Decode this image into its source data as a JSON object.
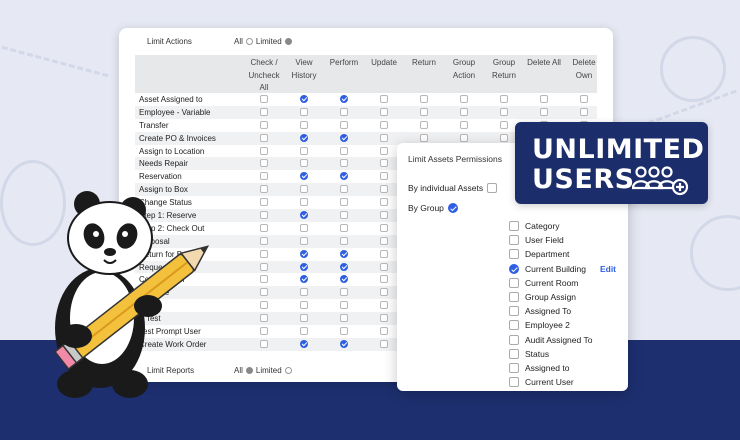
{
  "limit_actions": {
    "label": "Limit Actions",
    "all": "All",
    "limited": "Limited"
  },
  "limit_reports": {
    "label": "Limit Reports",
    "all": "All",
    "limited": "Limited"
  },
  "columns": [
    "Check / Uncheck All",
    "View History",
    "Perform",
    "Update",
    "Return",
    "Group Action",
    "Group Return",
    "Delete All",
    "Delete Own"
  ],
  "rows": [
    {
      "name": "Asset Assigned to",
      "checks": [
        false,
        true,
        true,
        false,
        false,
        false,
        false,
        false,
        false
      ]
    },
    {
      "name": "Employee - Variable",
      "checks": [
        false,
        false,
        false,
        false,
        false,
        false,
        false,
        false,
        false
      ]
    },
    {
      "name": "Transfer",
      "checks": [
        false,
        false,
        false,
        false,
        false,
        false,
        false,
        false,
        false
      ]
    },
    {
      "name": "Create PO & Invoices",
      "checks": [
        false,
        true,
        true,
        false,
        false,
        false,
        false,
        false,
        false
      ]
    },
    {
      "name": "Assign to Location",
      "checks": [
        false,
        false,
        false,
        false,
        false,
        false,
        false,
        false,
        false
      ]
    },
    {
      "name": "Needs Repair",
      "checks": [
        false,
        false,
        false,
        false,
        false,
        false,
        false,
        false,
        false
      ]
    },
    {
      "name": "Reservation",
      "checks": [
        false,
        true,
        true,
        false,
        false,
        false,
        false,
        false,
        false
      ]
    },
    {
      "name": "Assign to Box",
      "checks": [
        false,
        false,
        false,
        false,
        false,
        false,
        false,
        false,
        false
      ]
    },
    {
      "name": "Change Status",
      "checks": [
        false,
        false,
        false,
        false,
        false,
        false,
        false,
        false,
        false
      ]
    },
    {
      "name": "Step 1: Reserve",
      "checks": [
        false,
        true,
        false,
        false,
        false,
        false,
        false,
        false,
        false
      ]
    },
    {
      "name": "Step 2: Check Out",
      "checks": [
        false,
        false,
        false,
        false,
        false,
        false,
        false,
        false,
        false
      ]
    },
    {
      "name": "Disposal",
      "checks": [
        false,
        false,
        false,
        false,
        false,
        false,
        false,
        false,
        false
      ]
    },
    {
      "name": "Return for Break",
      "checks": [
        false,
        true,
        true,
        false,
        false,
        false,
        false,
        false,
        false
      ]
    },
    {
      "name": "Request Check",
      "checks": [
        false,
        true,
        true,
        false,
        false,
        false,
        false,
        false,
        false
      ]
    },
    {
      "name": "Confirmation",
      "checks": [
        false,
        true,
        true,
        false,
        false,
        false,
        false,
        false,
        false
      ]
    },
    {
      "name": "Rename",
      "checks": [
        false,
        false,
        false,
        false,
        false,
        false,
        false,
        false,
        false
      ]
    },
    {
      "name": "Audit",
      "checks": [
        false,
        false,
        false,
        false,
        false,
        false,
        false,
        false,
        false
      ]
    },
    {
      "name": "A Test",
      "checks": [
        false,
        false,
        false,
        false,
        false,
        false,
        false,
        false,
        false
      ]
    },
    {
      "name": "Test Prompt User",
      "checks": [
        false,
        false,
        false,
        false,
        false,
        false,
        false,
        false,
        false
      ]
    },
    {
      "name": "Create Work Order",
      "checks": [
        false,
        true,
        true,
        false,
        false,
        false,
        false,
        false,
        false
      ]
    }
  ],
  "popup": {
    "title": "Limit Assets Permissions",
    "by_individual": "By individual Assets",
    "by_group": "By Group",
    "groups": [
      {
        "label": "Category",
        "checked": false
      },
      {
        "label": "User Field",
        "checked": false
      },
      {
        "label": "Department",
        "checked": false
      },
      {
        "label": "Current Building",
        "checked": true
      },
      {
        "label": "Current Room",
        "checked": false
      },
      {
        "label": "Group Assign",
        "checked": false
      },
      {
        "label": "Assigned To",
        "checked": false
      },
      {
        "label": "Employee 2",
        "checked": false
      },
      {
        "label": "Audit Assigned To",
        "checked": false
      },
      {
        "label": "Status",
        "checked": false
      },
      {
        "label": "Assigned to",
        "checked": false
      },
      {
        "label": "Current User",
        "checked": false
      }
    ],
    "edit": "Edit"
  },
  "badge": {
    "line1": "UNLIMITED",
    "line2": "USERS",
    "icon": "add-users-icon"
  },
  "colors": {
    "accent": "#2f5fe3",
    "navy": "#1c2d6b",
    "background": "#e6e9f3"
  }
}
